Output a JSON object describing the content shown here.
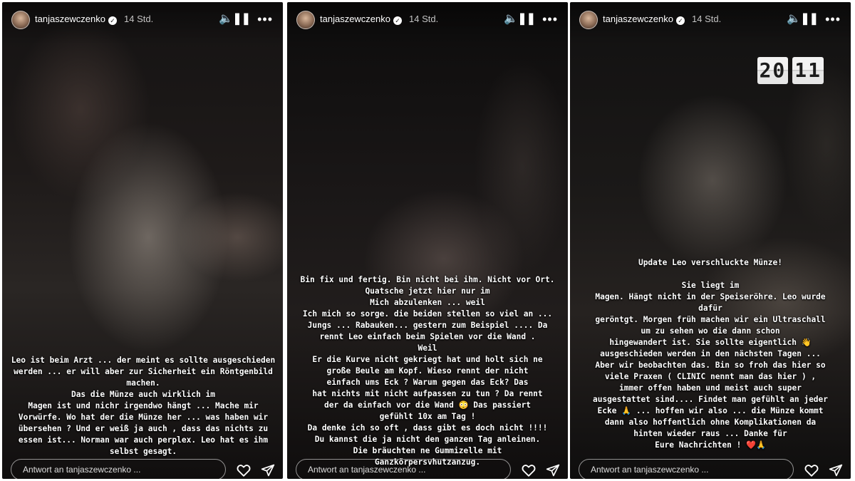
{
  "header": {
    "username": "tanjaszewczenko",
    "time_ago": "14 Std.",
    "verified_glyph": "✓",
    "sound_glyph": "🔈",
    "pause_glyph": "❚❚",
    "more_glyph": "•••"
  },
  "clock": {
    "hours": "20",
    "minutes": "11"
  },
  "stories": [
    {
      "overlay_text": "Leo ist beim Arzt ... der meint es sollte ausgeschieden\nwerden ... er will aber zur Sicherheit ein Röntgenbild\nmachen.\nDas die Münze auch wirklich im\nMagen ist und nichr irgendwo hängt ... Mache mir\nVorwürfe. Wo hat der die Münze her ... was haben wir\nübersehen ? Und er weiß ja auch , dass das nichts zu\nessen ist... Norman war auch perplex. Leo hat es ihm\nselbst gesagt.",
      "reply_placeholder": "Antwort an tanjaszewczenko ..."
    },
    {
      "overlay_text": "Bin fix und fertig. Bin nicht bei ihm. Nicht vor Ort.\nQuatsche jetzt hier nur im\nMich abzulenken ... weil\nIch mich so sorge. die beiden stellen so viel an ...\nJungs ... Rabauken... gestern zum Beispiel .... Da\nrennt Leo einfach beim Spielen vor die Wand .\nWeil\nEr die Kurve nicht gekriegt hat und holt sich ne\ngroße Beule am Kopf. Wieso rennt der nicht\neinfach ums Eck ? Warum gegen das Eck? Das\nhat nichts mit nicht aufpassen zu tun ? Da rennt\nder da einfach vor die Wand 😳 Das passiert\ngefühlt 10x am Tag !\nDa denke ich so oft , dass gibt es doch nicht !!!!\nDu kannst die ja nicht den ganzen Tag anleinen.\nDie bräuchten ne Gummizelle mit\nGanzkörpersvhutzanzug.",
      "reply_placeholder": "Antwort an tanjaszewczenko ..."
    },
    {
      "overlay_text": "Update Leo verschluckte Münze!\n\nSie liegt im\nMagen. Hängt nicht in der Speiseröhre. Leo wurde\ndafür\ngeröntgt. Morgen früh machen wir ein Ultraschall\num zu sehen wo die dann schon\nhingewandert ist. Sie sollte eigentlich 👋\nausgeschieden werden in den nächsten Tagen ...\nAber wir beobachten das. Bin so froh das hier so\nviele Praxen ( CLINIC nennt man das hier ) ,\nimmer offen haben  und meist auch super\nausgestattet sind.... Findet man gefühlt an jeder\nEcke 🙏 ... hoffen wir also ... die Münze kommt\ndann also hoffentlich ohne Komplikationen da\nhinten wieder raus ... Danke für\nEure Nachrichten ! ❤️🙏",
      "reply_placeholder": "Antwort an tanjaszewczenko ..."
    }
  ],
  "icons": [
    "avatar",
    "verified-badge-icon",
    "sound-icon",
    "pause-icon",
    "more-icon",
    "heart-icon",
    "send-icon"
  ],
  "colors": {
    "text": "#ffffff",
    "divider": "#ffffff"
  }
}
